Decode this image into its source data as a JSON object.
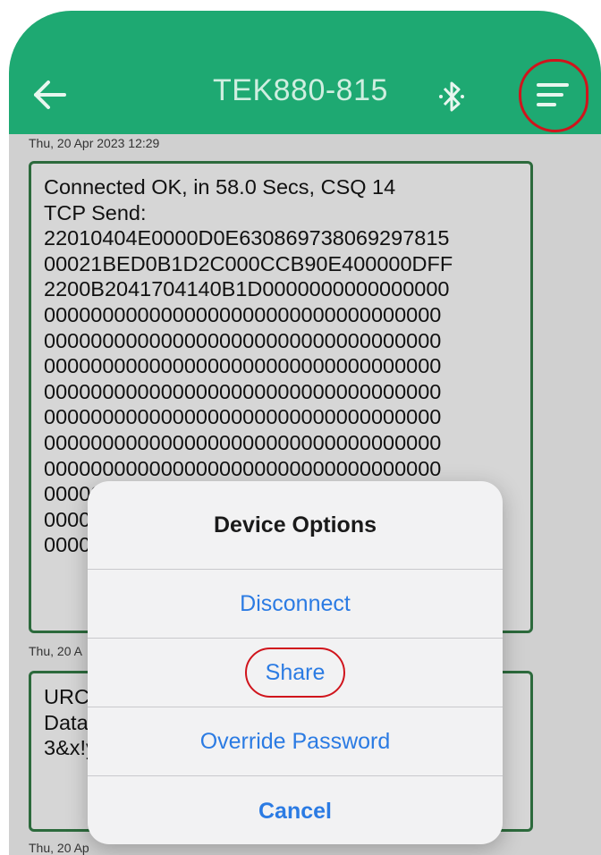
{
  "header": {
    "title": "TEK880-815",
    "back_icon": "arrow-left-icon",
    "bluetooth_icon": "bluetooth-icon",
    "menu_icon": "menu-lines-icon",
    "accent_color": "#1ea972"
  },
  "messages": [
    {
      "date": "Thu, 20 Apr 2023 12:29",
      "body": "Connected OK, in 58.0 Secs, CSQ 14\nTCP Send:\n22010404E0000D0E630869738069297815\n00021BED0B1D2C000CCB90E400000DFF\n2200B2041704140B1D0000000000000000\n0000000000000000000000000000000000\n0000000000000000000000000000000000\n0000000000000000000000000000000000\n0000000000000000000000000000000000\n0000000000000000000000000000000000\n0000000000000000000000000000000000\n0000000000000000000000000000000000\n0000000000000000000000000000000000\n0000000000000000000000000000000000\n0000"
    },
    {
      "date": "Thu, 20 A",
      "body": "URC\nData\n3&x!y"
    },
    {
      "date": "Thu, 20 Ap"
    }
  ],
  "dialog": {
    "title": "Device Options",
    "options": [
      "Disconnect",
      "Share",
      "Override Password"
    ],
    "cancel": "Cancel",
    "link_color": "#2b7be3",
    "annotation_color": "#d0141c"
  }
}
